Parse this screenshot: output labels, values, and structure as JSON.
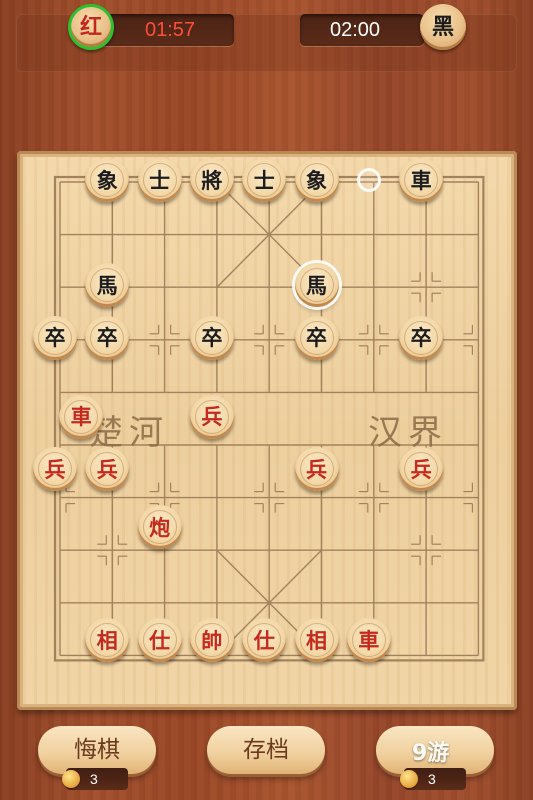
{
  "top_bar": {
    "red_side_label": "红",
    "red_timer": "01:57",
    "black_timer": "02:00",
    "black_side_label": "黑"
  },
  "board": {
    "river_left": "楚河",
    "river_right": "汉界",
    "pieces": [
      {
        "side": "black",
        "label": "象",
        "col": 1,
        "row": 0
      },
      {
        "side": "black",
        "label": "士",
        "col": 2,
        "row": 0
      },
      {
        "side": "black",
        "label": "將",
        "col": 3,
        "row": 0
      },
      {
        "side": "black",
        "label": "士",
        "col": 4,
        "row": 0
      },
      {
        "side": "black",
        "label": "象",
        "col": 5,
        "row": 0
      },
      {
        "side": "black",
        "label": "車",
        "col": 7,
        "row": 0
      },
      {
        "side": "black",
        "label": "馬",
        "col": 1,
        "row": 2
      },
      {
        "side": "black",
        "label": "馬",
        "col": 5,
        "row": 2,
        "selected": true
      },
      {
        "side": "black",
        "label": "卒",
        "col": 0,
        "row": 3
      },
      {
        "side": "black",
        "label": "卒",
        "col": 1,
        "row": 3
      },
      {
        "side": "black",
        "label": "卒",
        "col": 3,
        "row": 3
      },
      {
        "side": "black",
        "label": "卒",
        "col": 5,
        "row": 3
      },
      {
        "side": "black",
        "label": "卒",
        "col": 7,
        "row": 3
      },
      {
        "side": "red",
        "label": "車",
        "col": 0.5,
        "row": 4.5
      },
      {
        "side": "red",
        "label": "兵",
        "col": 3,
        "row": 4.5
      },
      {
        "side": "red",
        "label": "兵",
        "col": 0,
        "row": 5.5
      },
      {
        "side": "red",
        "label": "兵",
        "col": 1,
        "row": 5.5
      },
      {
        "side": "red",
        "label": "兵",
        "col": 5,
        "row": 5.5
      },
      {
        "side": "red",
        "label": "兵",
        "col": 7,
        "row": 5.5
      },
      {
        "side": "red",
        "label": "炮",
        "col": 2,
        "row": 6.6
      },
      {
        "side": "red",
        "label": "相",
        "col": 1,
        "row": 8.75
      },
      {
        "side": "red",
        "label": "仕",
        "col": 2,
        "row": 8.75
      },
      {
        "side": "red",
        "label": "帥",
        "col": 3,
        "row": 8.75
      },
      {
        "side": "red",
        "label": "仕",
        "col": 4,
        "row": 8.75
      },
      {
        "side": "red",
        "label": "相",
        "col": 5,
        "row": 8.75
      },
      {
        "side": "red",
        "label": "車",
        "col": 6,
        "row": 8.75
      }
    ],
    "move_hint": {
      "col": 6,
      "row": 0
    }
  },
  "bottom_bar": {
    "undo_label": "悔棋",
    "undo_count": "3",
    "save_label": "存档",
    "right_count": "3",
    "watermark": "9游"
  },
  "colors": {
    "red_piece_text": "#c52a1f",
    "black_piece_text": "#1d1d1d",
    "red_timer": "#ff4d3a",
    "active_turn_ring": "#2fbf2f"
  }
}
